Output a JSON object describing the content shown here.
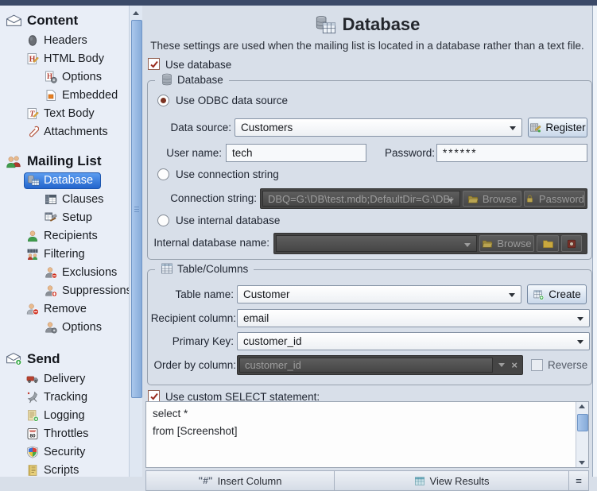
{
  "sidebar": {
    "sections": [
      {
        "label": "Content",
        "items": [
          {
            "label": "Headers"
          },
          {
            "label": "HTML Body"
          },
          {
            "label": "Options"
          },
          {
            "label": "Embedded"
          },
          {
            "label": "Text Body"
          },
          {
            "label": "Attachments"
          }
        ]
      },
      {
        "label": "Mailing List",
        "items": [
          {
            "label": "Database",
            "selected": true
          },
          {
            "label": "Clauses"
          },
          {
            "label": "Setup"
          },
          {
            "label": "Recipients"
          },
          {
            "label": "Filtering"
          },
          {
            "label": "Exclusions"
          },
          {
            "label": "Suppressions"
          },
          {
            "label": "Remove"
          },
          {
            "label": "Options"
          }
        ]
      },
      {
        "label": "Send",
        "items": [
          {
            "label": "Delivery"
          },
          {
            "label": "Tracking"
          },
          {
            "label": "Logging"
          },
          {
            "label": "Throttles"
          },
          {
            "label": "Security"
          },
          {
            "label": "Scripts"
          }
        ]
      }
    ]
  },
  "main": {
    "title": "Database",
    "subtitle": "These settings are used when the mailing list is located in a database rather than a text file.",
    "use_database_label": "Use database",
    "use_database_checked": true,
    "db_group": {
      "legend": "Database",
      "odbc_radio_label": "Use ODBC data source",
      "odbc_radio_selected": true,
      "data_source_label": "Data source:",
      "data_source_value": "Customers",
      "register_label": "Register",
      "user_name_label": "User name:",
      "user_name_value": "tech",
      "password_label": "Password:",
      "password_value": "******",
      "conn_radio_label": "Use connection string",
      "conn_radio_selected": false,
      "conn_label": "Connection string:",
      "conn_value": "DBQ=G:\\DB\\test.mdb;DefaultDir=G:\\DB;",
      "browse_label": "Browse",
      "password_btn_label": "Password",
      "internal_radio_label": "Use internal database",
      "internal_radio_selected": false,
      "internal_label": "Internal database name:",
      "internal_value": "",
      "browse2_label": "Browse"
    },
    "table_group": {
      "legend": "Table/Columns",
      "table_name_label": "Table name:",
      "table_name_value": "Customer",
      "create_label": "Create",
      "recipient_label": "Recipient column:",
      "recipient_value": "email",
      "primary_key_label": "Primary Key:",
      "primary_key_value": "customer_id",
      "order_by_label": "Order by column:",
      "order_by_value": "customer_id",
      "reverse_label": "Reverse",
      "reverse_checked": false
    },
    "custom_select_label": "Use custom SELECT statement:",
    "custom_select_checked": true,
    "sql_text": "select *\nfrom [Screenshot]",
    "bottom": {
      "insert_column": "Insert Column",
      "view_results": "View Results"
    }
  },
  "colors": {
    "selection_blue": "#2d6fd2",
    "check_red": "#9b2c1e",
    "disabled_field_bg": "#4a4a4a",
    "sidebar_bg": "#e9eef7",
    "panel_bg": "#d8dfe9",
    "topbar_bg": "#3b4a68"
  }
}
